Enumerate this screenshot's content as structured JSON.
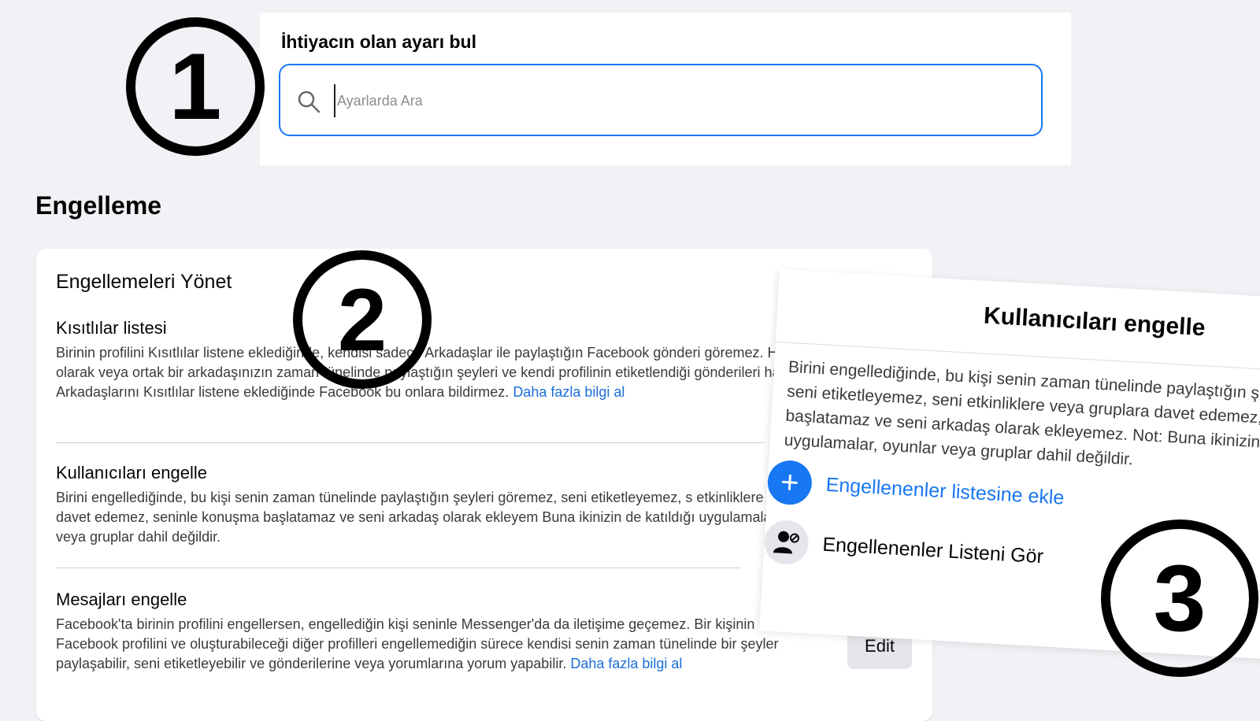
{
  "search": {
    "title": "İhtiyacın olan ayarı bul",
    "placeholder": "Ayarlarda Ara"
  },
  "section_title": "Engelleme",
  "card": {
    "title": "Engellemeleri Yönet",
    "items": [
      {
        "title": "Kısıtlılar listesi",
        "text": "Birinin profilini Kısıtlılar listene eklediğinde, kendisi sadece Arkadaşlar ile paylaştığın Facebook gönderi göremez. Herkese Açık olarak veya ortak bir arkadaşınızın zaman tünelinde paylaştığın şeyleri ve kendi profilinin etiketlendiği gönderileri hâlâ görebilir. Arkadaşlarını Kısıtlılar listene eklediğinde Facebook bu onlara bildirmez.",
        "link": "Daha fazla bilgi al"
      },
      {
        "title": "Kullanıcıları engelle",
        "text": "Birini engellediğinde, bu kişi senin zaman tünelinde paylaştığın şeyleri göremez, seni etiketleyemez, s etkinliklere veya gruplara davet edemez, seninle konuşma başlatamaz ve seni arkadaş olarak ekleyem Buna ikinizin de katıldığı uygulamalar, oyunlar veya gruplar dahil değildir.",
        "link": ""
      },
      {
        "title": "Mesajları engelle",
        "text": "Facebook'ta birinin profilini engellersen, engellediğin kişi seninle Messenger'da da iletişime geçemez. Bir kişinin Facebook profilini ve oluşturabileceği diğer profilleri engellemediğin sürece kendisi senin zaman tünelinde bir şeyler paylaşabilir, seni etiketleyebilir ve gönderilerine veya yorumlarına yorum yapabilir.",
        "link": "Daha fazla bilgi al"
      }
    ],
    "edit_label": "Edit"
  },
  "popup": {
    "title": "Kullanıcıları engelle",
    "desc_lines": [
      "Birini engellediğinde, bu kişi senin zaman tünelinde paylaştığın ş",
      "seni etiketleyemez, seni etkinliklere veya gruplara davet edemez,",
      "başlatamaz ve seni arkadaş olarak ekleyemez. Not: Buna ikinizin",
      "uygulamalar, oyunlar veya gruplar dahil değildir."
    ],
    "add_label": "Engellenenler listesine ekle",
    "view_label": "Engellenenler Listeni Gör"
  },
  "badges": [
    "1",
    "2",
    "3"
  ],
  "colors": {
    "accent": "#1877f2",
    "link": "#1a6ed8",
    "background": "#f0f2f5"
  }
}
